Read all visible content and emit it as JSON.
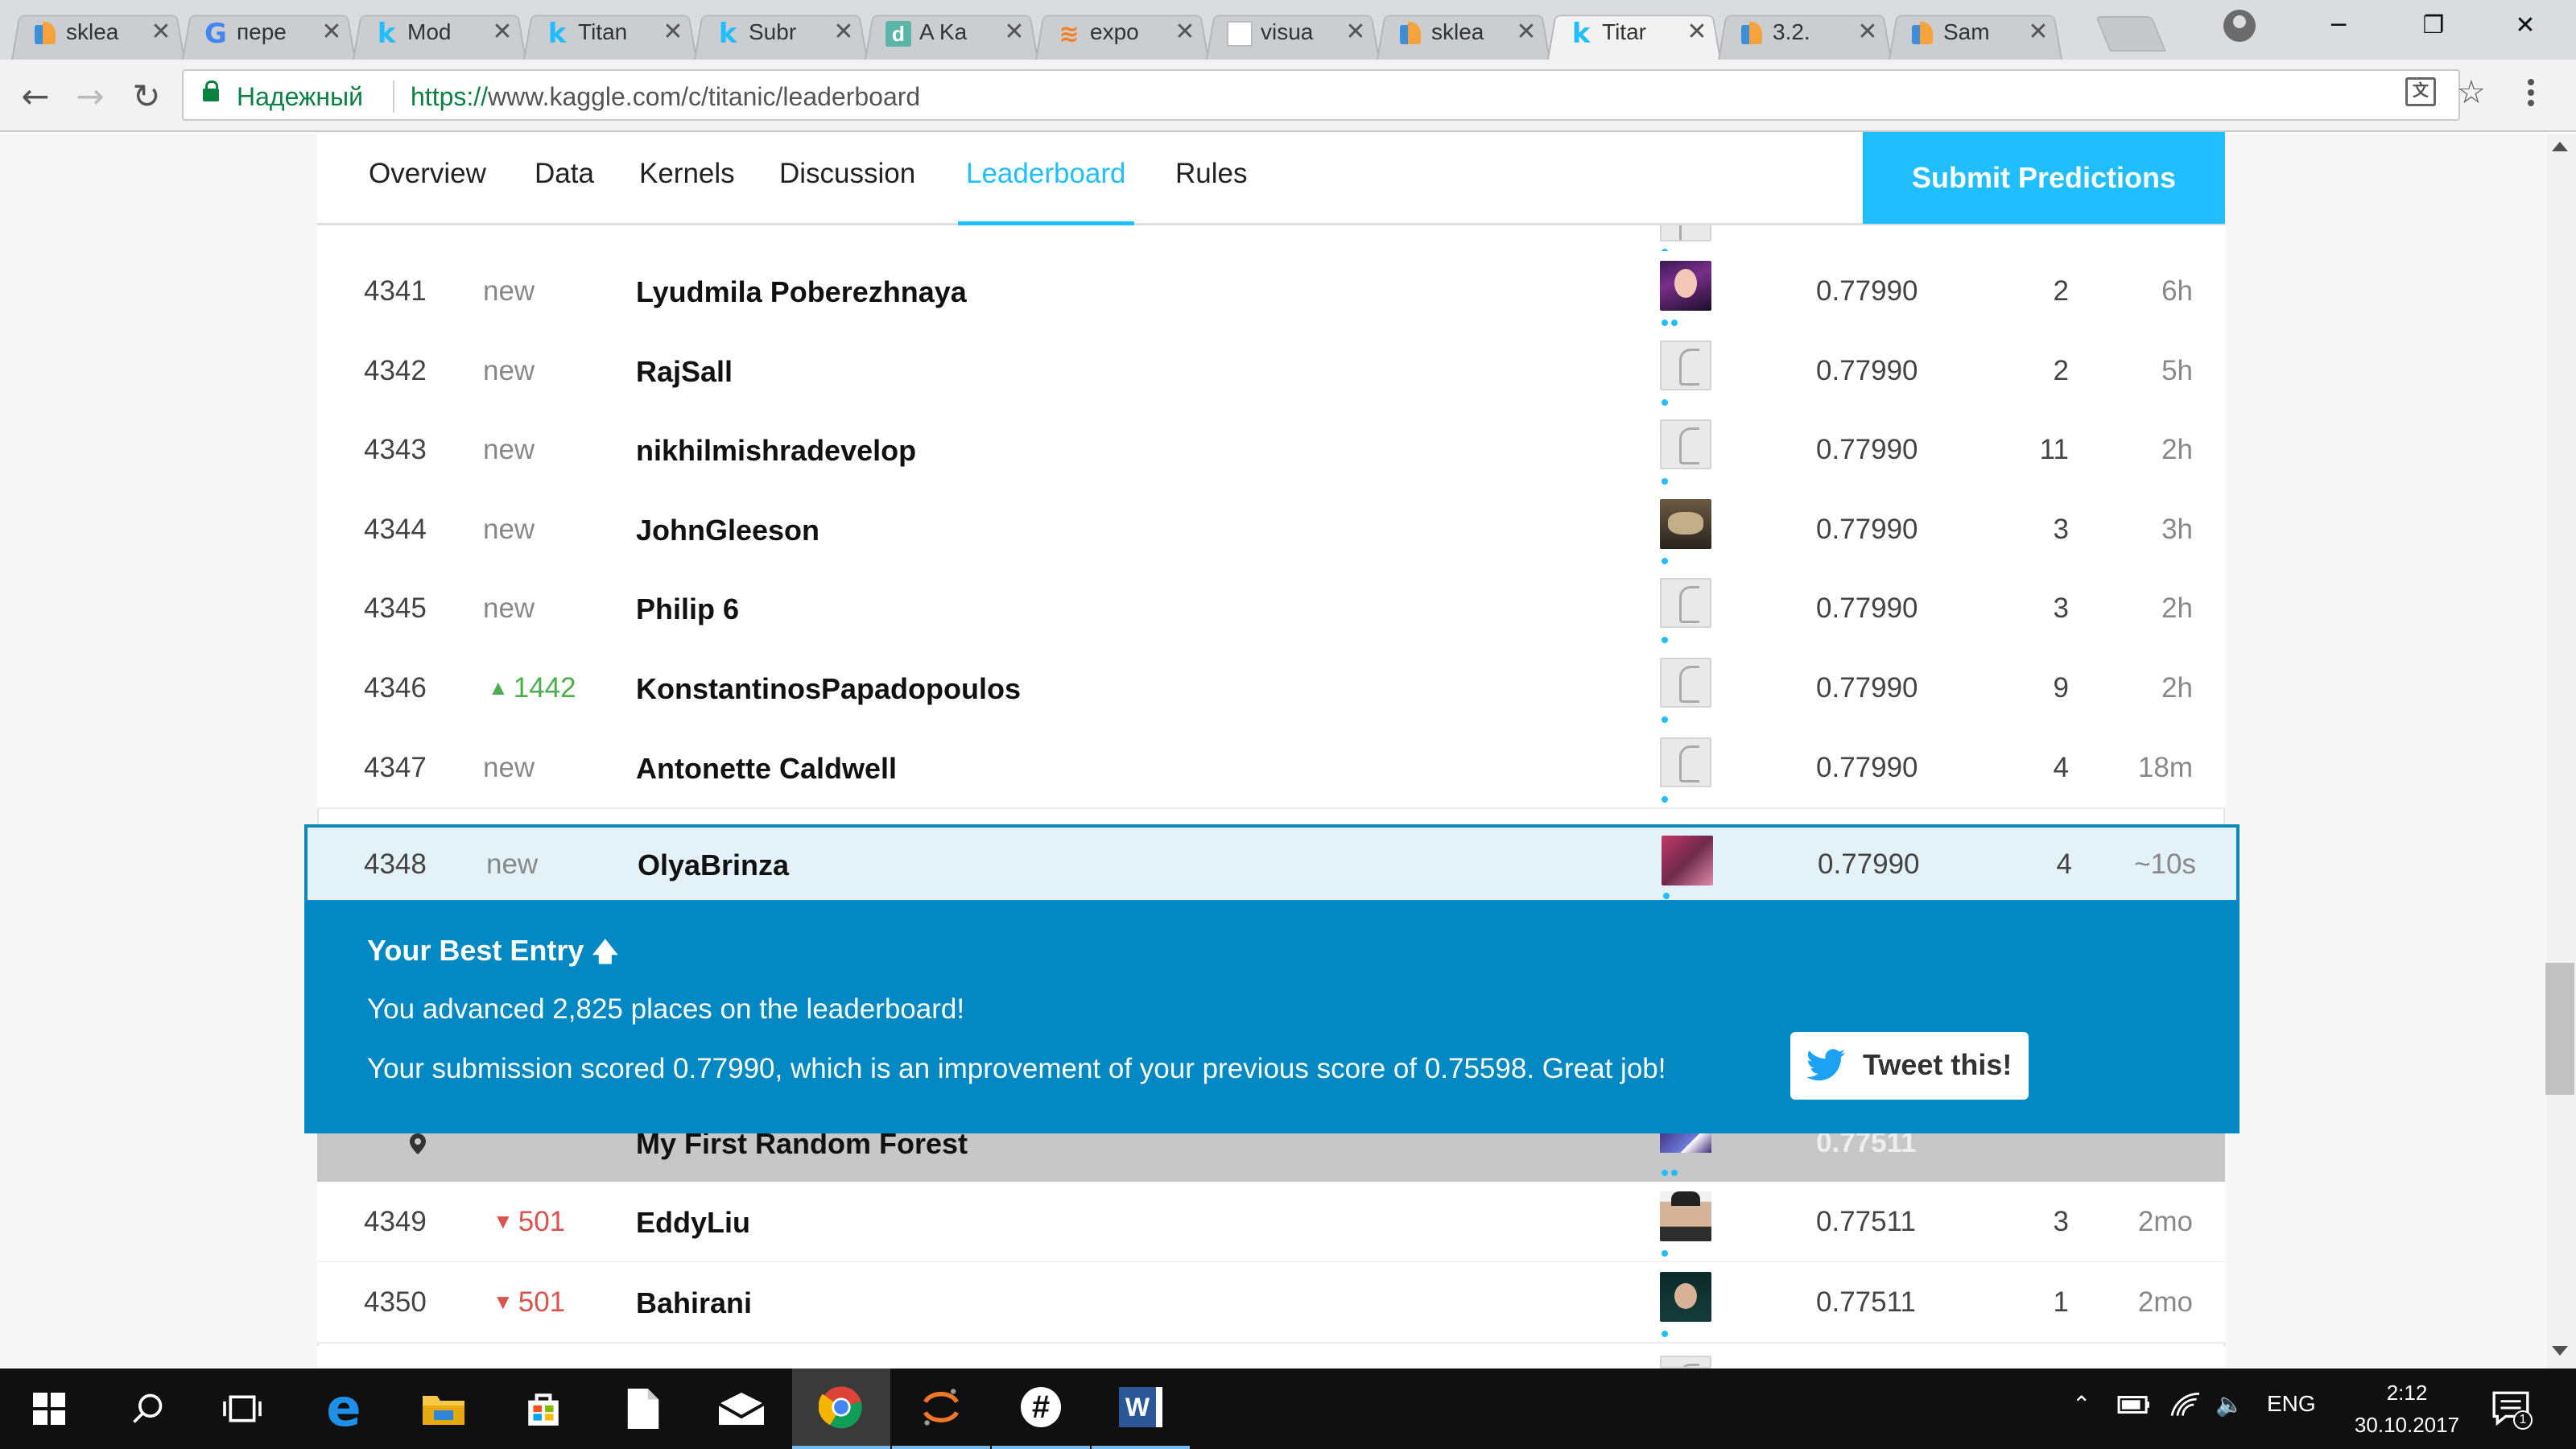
{
  "browser": {
    "tabs": [
      {
        "icon": "sklearn-icon",
        "title": "sklea",
        "active": false
      },
      {
        "icon": "google-icon",
        "title": "пере",
        "active": false
      },
      {
        "icon": "kaggle-icon",
        "title": "Mod",
        "active": false
      },
      {
        "icon": "kaggle-icon",
        "title": "Titan",
        "active": false
      },
      {
        "icon": "kaggle-icon",
        "title": "Subr",
        "active": false
      },
      {
        "icon": "d-icon",
        "title": "A Ka",
        "active": false
      },
      {
        "icon": "stackoverflow-icon",
        "title": "expo",
        "active": false
      },
      {
        "icon": "doc-icon",
        "title": "visua",
        "active": false
      },
      {
        "icon": "sklearn-icon",
        "title": "sklea",
        "active": false
      },
      {
        "icon": "kaggle-icon",
        "title": "Titar",
        "active": true
      },
      {
        "icon": "sklearn-icon",
        "title": "3.2.",
        "active": false
      },
      {
        "icon": "sklearn-icon",
        "title": "Sam",
        "active": false
      }
    ],
    "close_glyph": "✕",
    "secure_label": "Надежный",
    "url_scheme": "https://",
    "url_host": "www.kaggle.com",
    "url_path": "/c/titanic/leaderboard"
  },
  "nav": {
    "tabs": [
      "Overview",
      "Data",
      "Kernels",
      "Discussion",
      "Leaderboard",
      "Rules"
    ],
    "active_tab": "Leaderboard",
    "submit_label": "Submit Predictions"
  },
  "leaderboard": {
    "rows": [
      {
        "rank": "4341",
        "change": "new",
        "change_type": "new",
        "team": "Lyudmila Poberezhnaya",
        "avatar": "avatar-photo",
        "score": "0.77990",
        "entries": "2",
        "last": "6h"
      },
      {
        "rank": "4342",
        "change": "new",
        "change_type": "new",
        "team": "RajSall",
        "avatar": "avatar-default",
        "score": "0.77990",
        "entries": "2",
        "last": "5h"
      },
      {
        "rank": "4343",
        "change": "new",
        "change_type": "new",
        "team": "nikhilmishradevelop",
        "avatar": "avatar-default",
        "score": "0.77990",
        "entries": "11",
        "last": "2h"
      },
      {
        "rank": "4344",
        "change": "new",
        "change_type": "new",
        "team": "JohnGleeson",
        "avatar": "avatar-photo",
        "score": "0.77990",
        "entries": "3",
        "last": "3h"
      },
      {
        "rank": "4345",
        "change": "new",
        "change_type": "new",
        "team": "Philip 6",
        "avatar": "avatar-default",
        "score": "0.77990",
        "entries": "3",
        "last": "2h"
      },
      {
        "rank": "4346",
        "change": "1442",
        "change_type": "up",
        "team": "KonstantinosPapadopoulos",
        "avatar": "avatar-default",
        "score": "0.77990",
        "entries": "9",
        "last": "2h"
      },
      {
        "rank": "4347",
        "change": "new",
        "change_type": "new",
        "team": "Antonette Caldwell",
        "avatar": "avatar-default",
        "score": "0.77990",
        "entries": "4",
        "last": "18m"
      }
    ],
    "highlight_row": {
      "rank": "4348",
      "change": "new",
      "team": "OlyaBrinza",
      "score": "0.77990",
      "entries": "4",
      "last": "~10s"
    },
    "grey_row": {
      "team": "My First Random Forest",
      "score": "0.77511"
    },
    "rows_after": [
      {
        "rank": "4349",
        "change": "501",
        "change_type": "down",
        "team": "EddyLiu",
        "avatar": "avatar-photo",
        "score": "0.77511",
        "entries": "3",
        "last": "2mo"
      },
      {
        "rank": "4350",
        "change": "501",
        "change_type": "down",
        "team": "Bahirani",
        "avatar": "avatar-photo",
        "score": "0.77511",
        "entries": "1",
        "last": "2mo"
      }
    ]
  },
  "best_entry": {
    "title": "Your Best Entry",
    "line1": "You advanced 2,825 places on the leaderboard!",
    "line2": "Your submission scored 0.77990, which is an improvement of your previous score of 0.75598. Great job!",
    "tweet_label": "Tweet this!"
  },
  "taskbar": {
    "lang": "ENG",
    "time": "2:12",
    "date": "30.10.2017",
    "notification_count": "1"
  },
  "colors": {
    "kaggle_blue": "#20beff",
    "banner_blue": "#0288c2",
    "up_green": "#4cae4c",
    "down_red": "#d9534f"
  }
}
